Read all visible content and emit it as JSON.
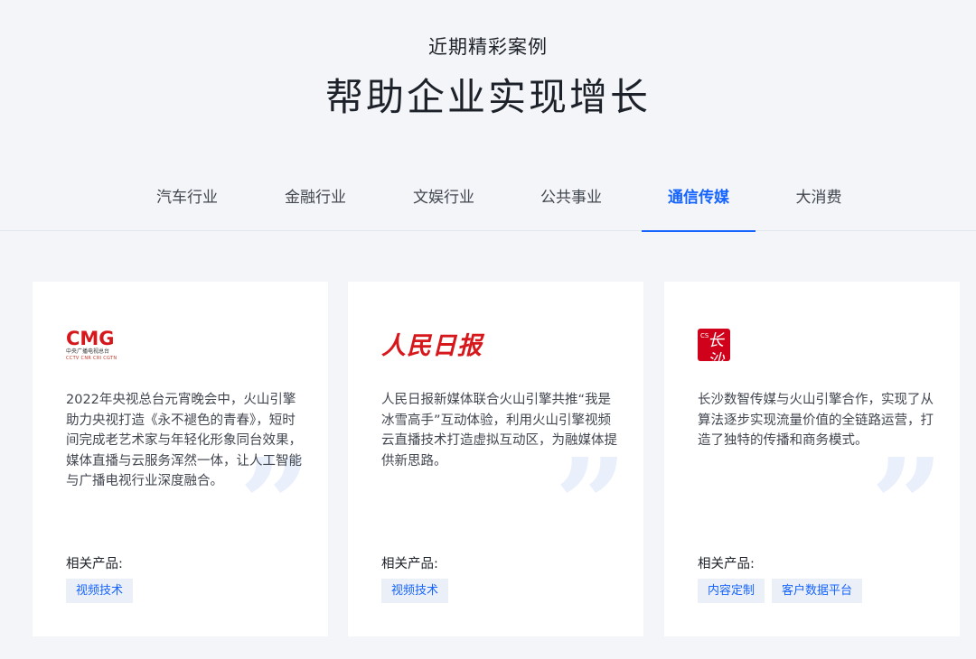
{
  "header": {
    "subtitle": "近期精彩案例",
    "title": "帮助企业实现增长"
  },
  "tabs": [
    {
      "label": "汽车行业",
      "active": false
    },
    {
      "label": "金融行业",
      "active": false
    },
    {
      "label": "文娱行业",
      "active": false
    },
    {
      "label": "公共事业",
      "active": false
    },
    {
      "label": "通信传媒",
      "active": true
    },
    {
      "label": "大消费",
      "active": false
    }
  ],
  "colors": {
    "accent": "#1664ff",
    "brand_red": "#d6181c"
  },
  "cards": [
    {
      "logo": {
        "text": "CMG",
        "sub": "中央广播电视总台",
        "sub2": "CCTV CNR CRI CGTN"
      },
      "description": "2022年央视总台元宵晚会中，火山引擎助力央视打造《永不褪色的青春》，短时间完成老艺术家与年轻化形象同台效果，媒体直播与云服务浑然一体，让人工智能与广播电视行业深度融合。",
      "quote_glyph": "”",
      "related_label": "相关产品:",
      "tags": [
        "视频技术"
      ]
    },
    {
      "logo": {
        "text": "人民日报"
      },
      "description": "人民日报新媒体联合火山引擎共推“我是冰雪高手”互动体验，利用火山引擎视频云直播技术打造虚拟互动区，为融媒体提供新思路。",
      "quote_glyph": "”",
      "related_label": "相关产品:",
      "tags": [
        "视频技术"
      ]
    },
    {
      "logo": {
        "text_a": "CS",
        "text_b": "长沙"
      },
      "description": "长沙数智传媒与火山引擎合作，实现了从算法逐步实现流量价值的全链路运营，打造了独特的传播和商务模式。",
      "quote_glyph": "”",
      "related_label": "相关产品:",
      "tags": [
        "内容定制",
        "客户数据平台"
      ]
    }
  ]
}
